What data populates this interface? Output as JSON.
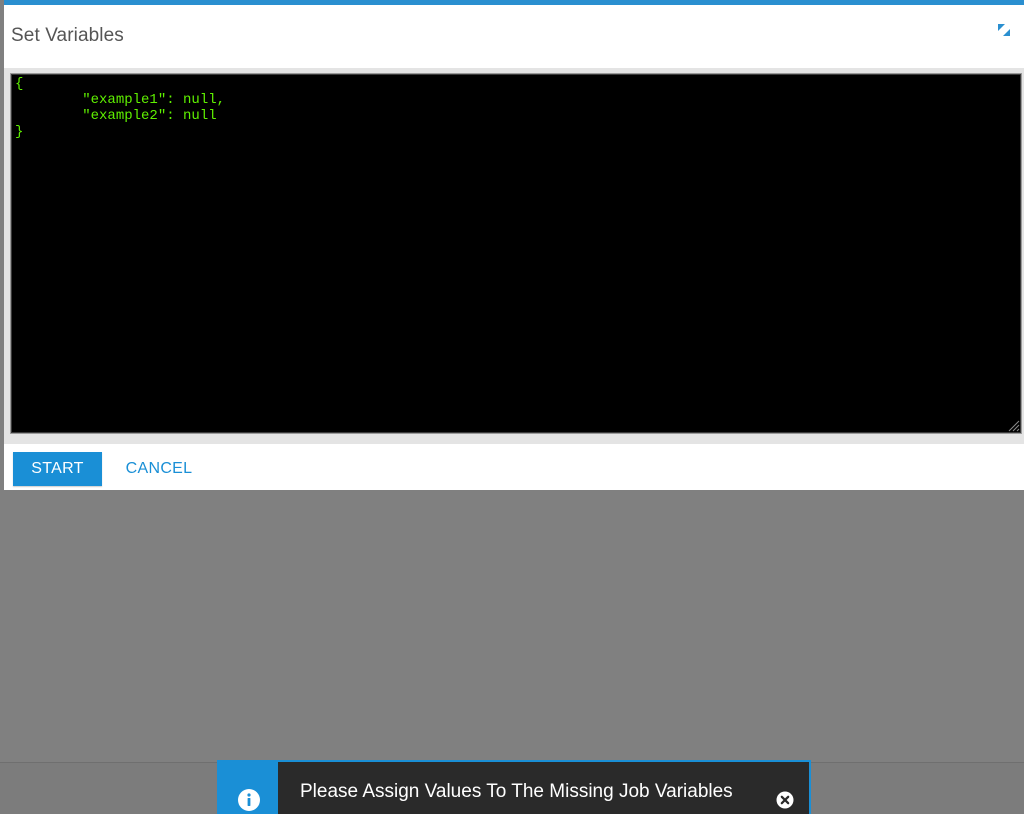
{
  "dialog": {
    "title": "Set Variables",
    "expand_icon": "expand-icon",
    "editor_content": "{\n        \"example1\": null,\n        \"example2\": null\n}",
    "start_label": "START",
    "cancel_label": "CANCEL"
  },
  "toast": {
    "icon": "info-icon",
    "message": "Please Assign Values To The Missing Job Variables",
    "close_icon": "close-icon"
  },
  "colors": {
    "accent": "#1a8fd6",
    "editor_text": "#5ff000",
    "editor_bg": "#000000",
    "overlay": "#808080"
  }
}
